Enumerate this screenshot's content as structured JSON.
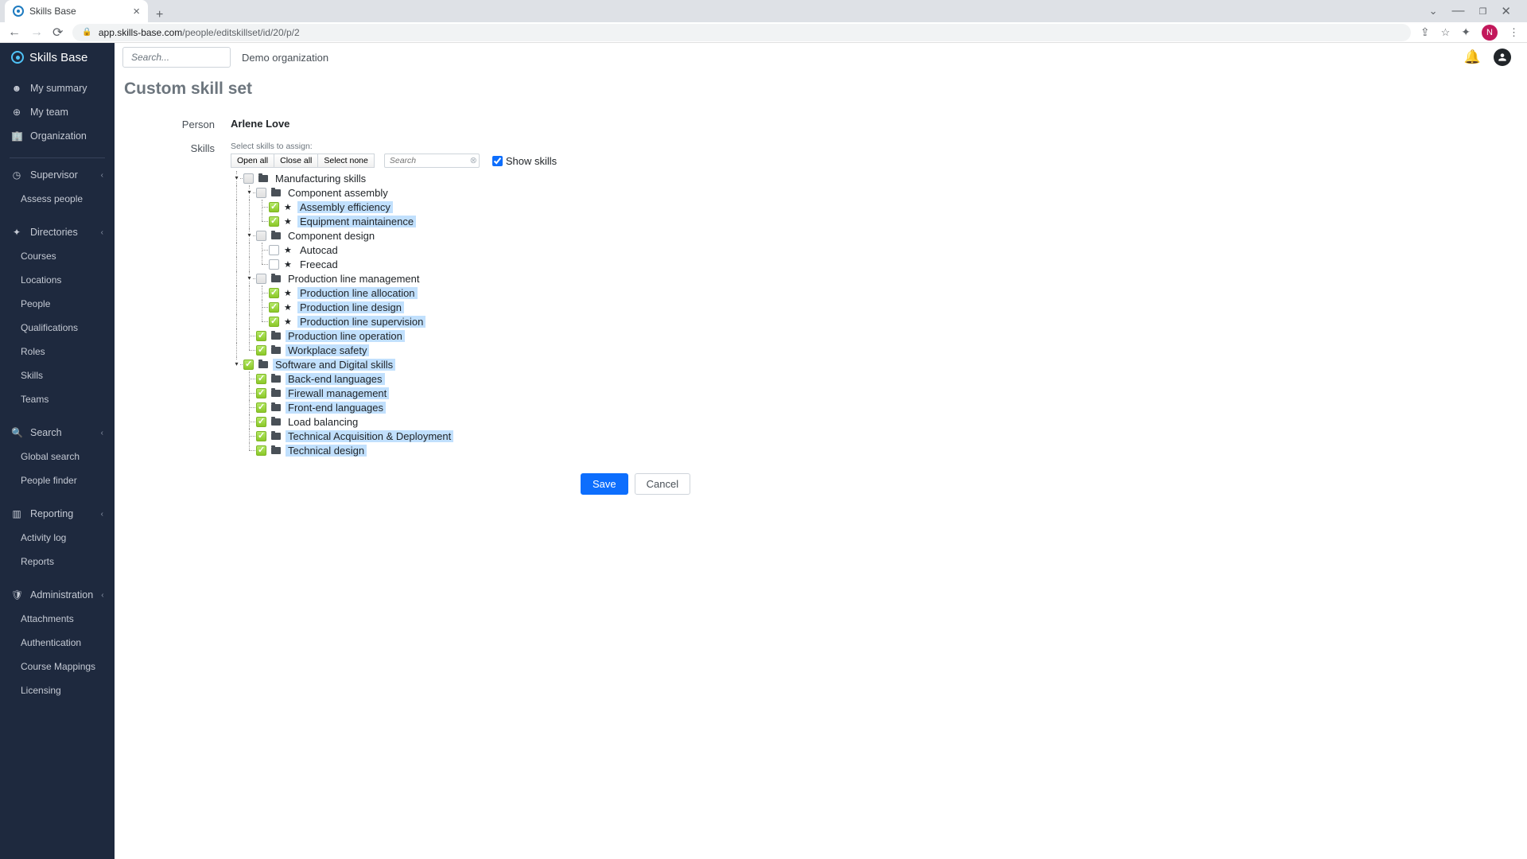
{
  "browser": {
    "tab_title": "Skills Base",
    "url_host": "app.skills-base.com",
    "url_path": "/people/editskillset/id/20/p/2",
    "avatar_letter": "N"
  },
  "brand": "Skills Base",
  "search_placeholder": "Search...",
  "org_name": "Demo organization",
  "sidebar": {
    "my_summary": "My summary",
    "my_team": "My team",
    "organization": "Organization",
    "supervisor": "Supervisor",
    "assess_people": "Assess people",
    "directories": "Directories",
    "courses": "Courses",
    "locations": "Locations",
    "people": "People",
    "qualifications": "Qualifications",
    "roles": "Roles",
    "skills": "Skills",
    "teams": "Teams",
    "search": "Search",
    "global_search": "Global search",
    "people_finder": "People finder",
    "reporting": "Reporting",
    "activity_log": "Activity log",
    "reports": "Reports",
    "administration": "Administration",
    "attachments": "Attachments",
    "authentication": "Authentication",
    "course_mappings": "Course Mappings",
    "licensing": "Licensing"
  },
  "page": {
    "title": "Custom skill set",
    "person_label": "Person",
    "person_value": "Arlene Love",
    "skills_label": "Skills",
    "select_hint": "Select skills to assign:",
    "open_all": "Open all",
    "close_all": "Close all",
    "select_none": "Select none",
    "tree_search_placeholder": "Search",
    "show_skills": "Show skills",
    "save": "Save",
    "cancel": "Cancel"
  },
  "tree": {
    "manufacturing": "Manufacturing skills",
    "component_assembly": "Component assembly",
    "assembly_efficiency": "Assembly efficiency",
    "equipment_maint": "Equipment maintainence",
    "component_design": "Component design",
    "autocad": "Autocad",
    "freecad": "Freecad",
    "prod_line_mgmt": "Production line management",
    "prod_alloc": "Production line allocation",
    "prod_design": "Production line design",
    "prod_supervision": "Production line supervision",
    "prod_operation": "Production line operation",
    "workplace_safety": "Workplace safety",
    "software_digital": "Software and Digital skills",
    "back_end": "Back-end languages",
    "firewall": "Firewall management",
    "front_end": "Front-end languages",
    "load_balancing": "Load balancing",
    "tech_acq": "Technical Acquisition & Deployment",
    "tech_design": "Technical design"
  }
}
